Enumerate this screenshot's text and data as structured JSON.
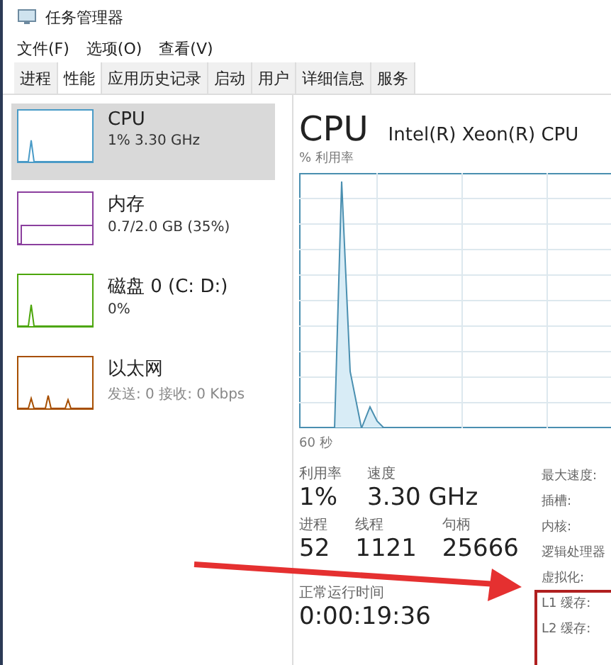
{
  "window": {
    "title": "任务管理器"
  },
  "menu": [
    "文件(F)",
    "选项(O)",
    "查看(V)"
  ],
  "tabs": [
    {
      "label": "进程",
      "selected": false
    },
    {
      "label": "性能",
      "selected": true
    },
    {
      "label": "应用历史记录",
      "selected": false
    },
    {
      "label": "启动",
      "selected": false
    },
    {
      "label": "用户",
      "selected": false
    },
    {
      "label": "详细信息",
      "selected": false
    },
    {
      "label": "服务",
      "selected": false
    }
  ],
  "sidebar": {
    "items": [
      {
        "name": "CPU",
        "detail": "1% 3.30 GHz",
        "selected": true,
        "color": "#4a9bc7",
        "kind": "spike"
      },
      {
        "name": "内存",
        "detail": "0.7/2.0 GB (35%)",
        "selected": false,
        "color": "#8b3f9e",
        "kind": "flat"
      },
      {
        "name": "磁盘 0 (C: D:)",
        "detail": "0%",
        "selected": false,
        "color": "#4da60c",
        "kind": "spike"
      },
      {
        "name": "以太网",
        "detail": "发送: 0 接收: 0 Kbps",
        "selected": false,
        "color": "#a74f01",
        "kind": "spikes"
      }
    ]
  },
  "detail": {
    "title": "CPU",
    "model": "Intel(R) Xeon(R) CPU",
    "chart_label": "% 利用率",
    "time_label": "60 秒",
    "stats": [
      {
        "label": "利用率",
        "value": "1%"
      },
      {
        "label": "速度",
        "value": "3.30 GHz"
      }
    ],
    "stats2": [
      {
        "label": "进程",
        "value": "52"
      },
      {
        "label": "线程",
        "value": "1121"
      },
      {
        "label": "句柄",
        "value": "25666"
      }
    ],
    "uptime": {
      "label": "正常运行时间",
      "value": "0:00:19:36"
    },
    "specs": [
      "最大速度:",
      "插槽:",
      "内核:",
      "逻辑处理器",
      "虚拟化:",
      "L1 缓存:",
      "L2 缓存:"
    ]
  }
}
